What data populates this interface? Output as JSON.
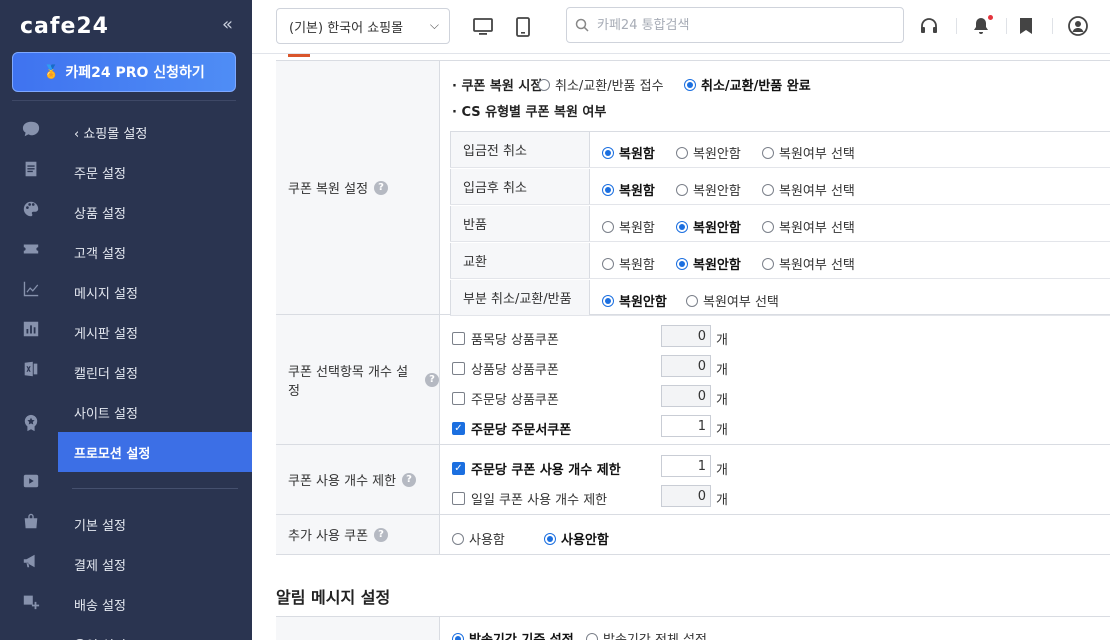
{
  "brand": {
    "logo": "cafe24",
    "collapse": "«",
    "pro_button": "카페24 PRO 신청하기"
  },
  "menu": {
    "back": "쇼핑몰 설정",
    "items_top": [
      {
        "label": "주문 설정",
        "active": false
      },
      {
        "label": "상품 설정",
        "active": false
      },
      {
        "label": "고객 설정",
        "active": false
      },
      {
        "label": "메시지 설정",
        "active": false
      },
      {
        "label": "게시판 설정",
        "active": false
      },
      {
        "label": "캘린더 설정",
        "active": false
      },
      {
        "label": "사이트 설정",
        "active": false
      },
      {
        "label": "프로모션 설정",
        "active": true
      }
    ],
    "items_bottom": [
      {
        "label": "기본 설정"
      },
      {
        "label": "결제 설정"
      },
      {
        "label": "배송 설정"
      },
      {
        "label": "운영 설정"
      }
    ]
  },
  "header": {
    "shop_select": "(기본) 한국어 쇼핑몰",
    "search_placeholder": "카페24 통합검색",
    "colors": {
      "accent": "#3c6fe6",
      "notice_dot": "#e4343d"
    }
  },
  "coupon_restore": {
    "label": "쿠폰 복원 설정",
    "timing_title": "쿠폰 복원 시점",
    "timing_options": [
      {
        "label": "취소/교환/반품 접수",
        "selected": false
      },
      {
        "label": "취소/교환/반품 완료",
        "selected": true
      }
    ],
    "cs_title": "CS 유형별 쿠폰 복원 여부",
    "cs_rows": [
      {
        "label": "입금전 취소",
        "options": [
          {
            "label": "복원함",
            "selected": true
          },
          {
            "label": "복원안함",
            "selected": false
          },
          {
            "label": "복원여부 선택",
            "selected": false
          }
        ]
      },
      {
        "label": "입금후 취소",
        "options": [
          {
            "label": "복원함",
            "selected": true
          },
          {
            "label": "복원안함",
            "selected": false
          },
          {
            "label": "복원여부 선택",
            "selected": false
          }
        ]
      },
      {
        "label": "반품",
        "options": [
          {
            "label": "복원함",
            "selected": false
          },
          {
            "label": "복원안함",
            "selected": true
          },
          {
            "label": "복원여부 선택",
            "selected": false
          }
        ]
      },
      {
        "label": "교환",
        "options": [
          {
            "label": "복원함",
            "selected": false
          },
          {
            "label": "복원안함",
            "selected": true
          },
          {
            "label": "복원여부 선택",
            "selected": false
          }
        ]
      },
      {
        "label": "부분 취소/교환/반품",
        "options": [
          {
            "label": "복원안함",
            "selected": true
          },
          {
            "label": "복원여부 선택",
            "selected": false
          }
        ]
      }
    ]
  },
  "coupon_count": {
    "label": "쿠폰 선택항목 개수 설정",
    "unit": "개",
    "items": [
      {
        "label": "품목당 상품쿠폰",
        "checked": false,
        "value": "0"
      },
      {
        "label": "상품당 상품쿠폰",
        "checked": false,
        "value": "0"
      },
      {
        "label": "주문당 상품쿠폰",
        "checked": false,
        "value": "0"
      },
      {
        "label": "주문당 주문서쿠폰",
        "checked": true,
        "value": "1"
      }
    ]
  },
  "coupon_limit": {
    "label": "쿠폰 사용 개수 제한",
    "unit": "개",
    "items": [
      {
        "label": "주문당 쿠폰 사용 개수 제한",
        "checked": true,
        "value": "1"
      },
      {
        "label": "일일 쿠폰 사용 개수 제한",
        "checked": false,
        "value": "0"
      }
    ]
  },
  "extra_coupon": {
    "label": "추가 사용 쿠폰",
    "options": [
      {
        "label": "사용함",
        "selected": false
      },
      {
        "label": "사용안함",
        "selected": true
      }
    ]
  },
  "notification": {
    "title": "알림 메시지 설정",
    "options": [
      {
        "label": "발송기간 기준 설정",
        "selected": true
      },
      {
        "label": "발송기간 전체 설정",
        "selected": false
      }
    ]
  }
}
